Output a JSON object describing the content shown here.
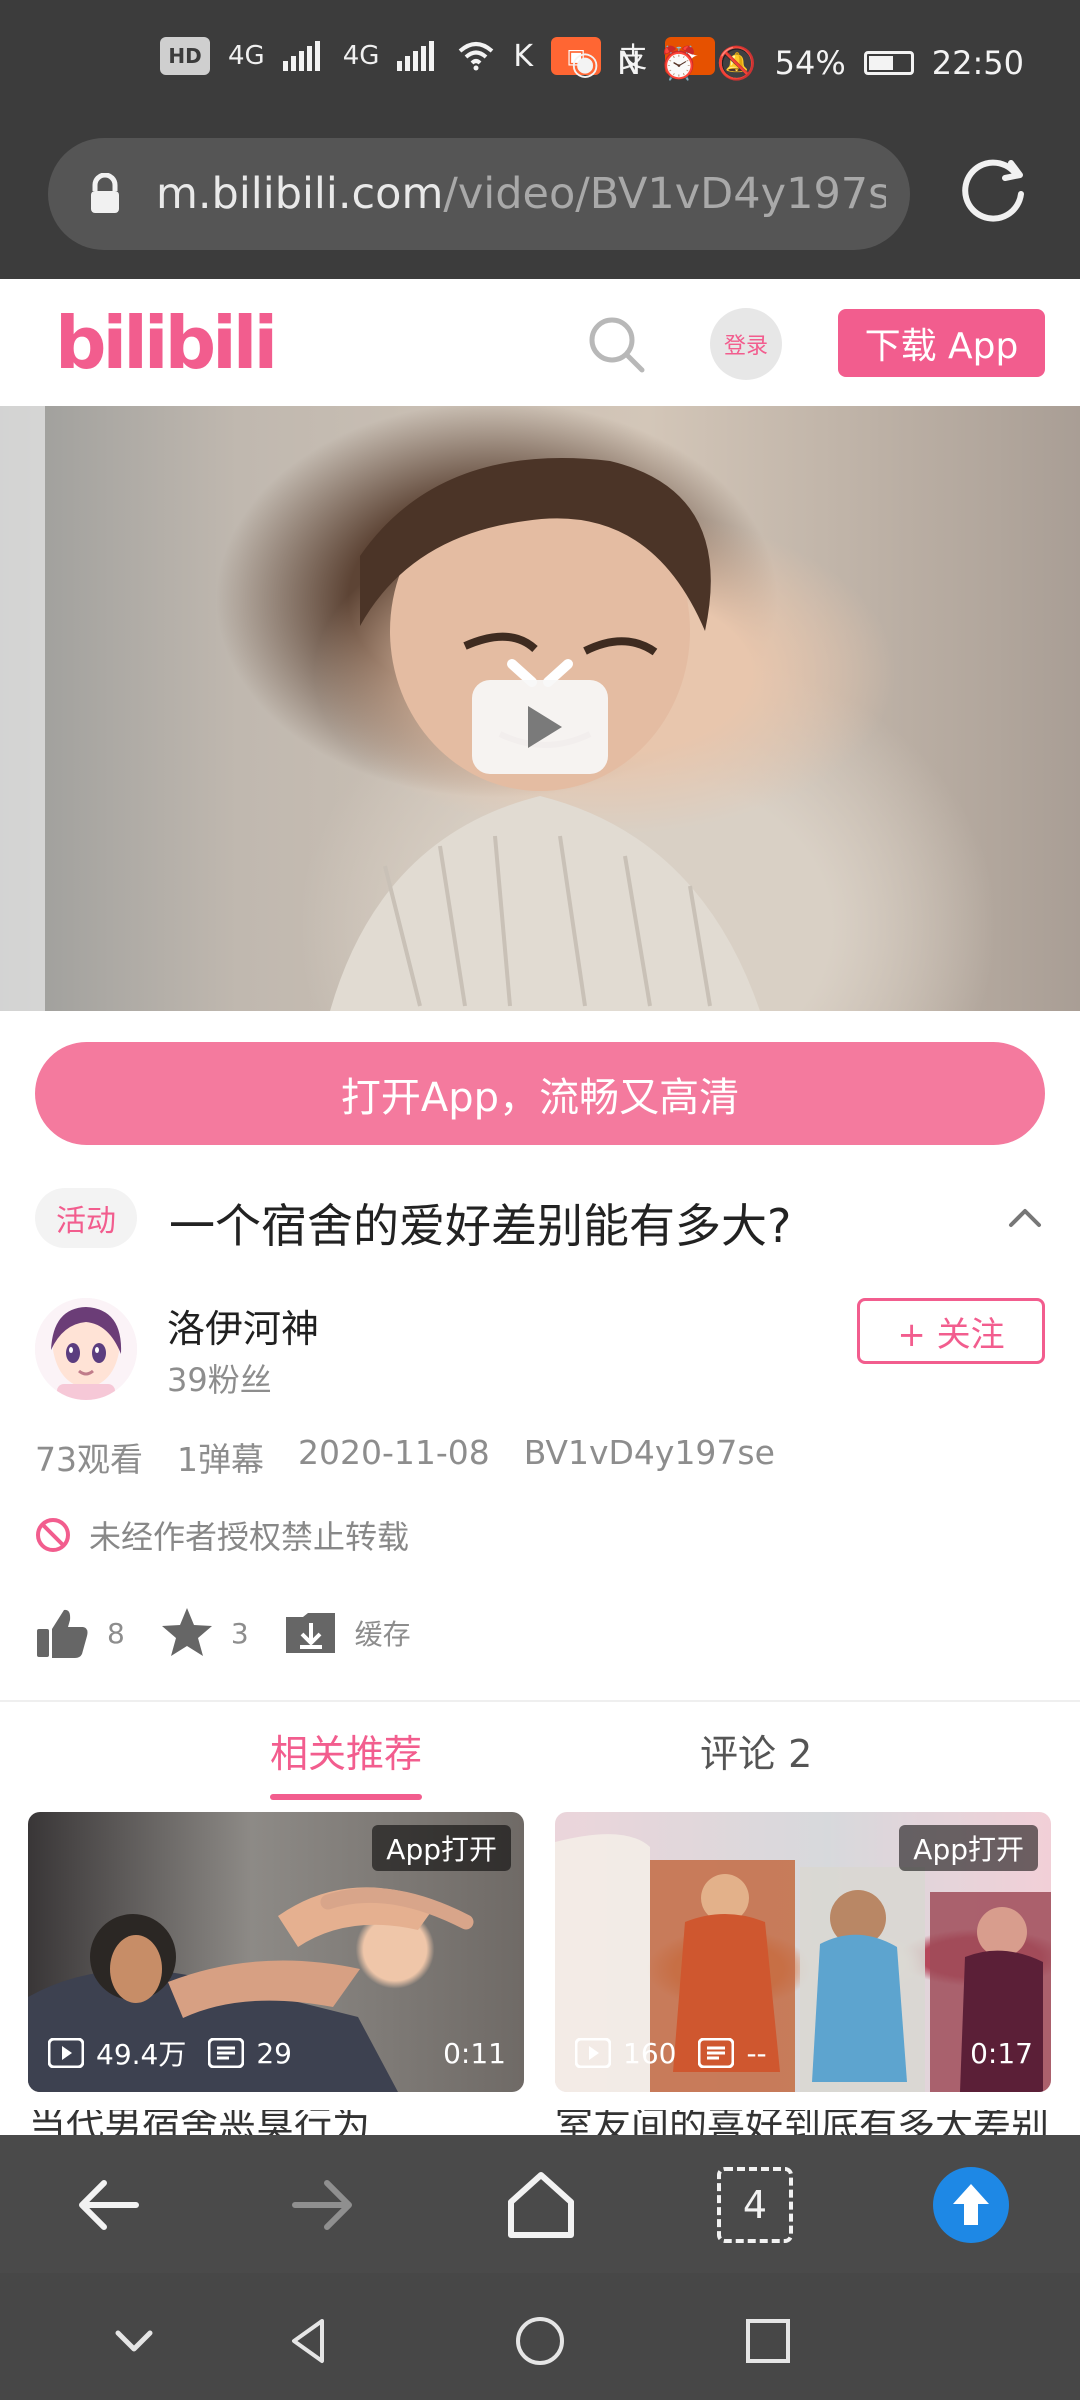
{
  "status_bar": {
    "signal_1": "4G",
    "signal_2": "4G",
    "battery": "54%",
    "time": "22:50"
  },
  "browser": {
    "url_domain": "m.bilibili.com",
    "url_path": "/video/BV1vD4y197s"
  },
  "site_header": {
    "logo": "bilibili",
    "login": "登录",
    "download": "下载 App"
  },
  "video": {
    "open_app": "打开App，流畅又高清",
    "tag": "活动",
    "title": "一个宿舍的爱好差别能有多大?"
  },
  "author": {
    "name": "洛伊河神",
    "fans": "39粉丝",
    "follow": "+ 关注"
  },
  "meta": {
    "views": "73观看",
    "danmaku": "1弹幕",
    "date": "2020-11-08",
    "bvid": "BV1vD4y197se"
  },
  "copyright": "未经作者授权禁止转载",
  "actions": {
    "likes": "8",
    "favorites": "3",
    "cache": "缓存"
  },
  "tabs": {
    "related": "相关推荐",
    "comments": "评论 2"
  },
  "related_videos": [
    {
      "app_open": "App打开",
      "plays": "49.4万",
      "comments": "29",
      "duration": "0:11",
      "title": "当代男宿舍恶臭行为"
    },
    {
      "app_open": "App打开",
      "plays": "160",
      "comments": "--",
      "duration": "0:17",
      "title": "室友间的喜好到底有多大差别?"
    }
  ],
  "tab_count": "4",
  "colors": {
    "brand": "#f25d8e",
    "chrome": "#3c3c3c",
    "accent_blue": "#1e88e5"
  }
}
